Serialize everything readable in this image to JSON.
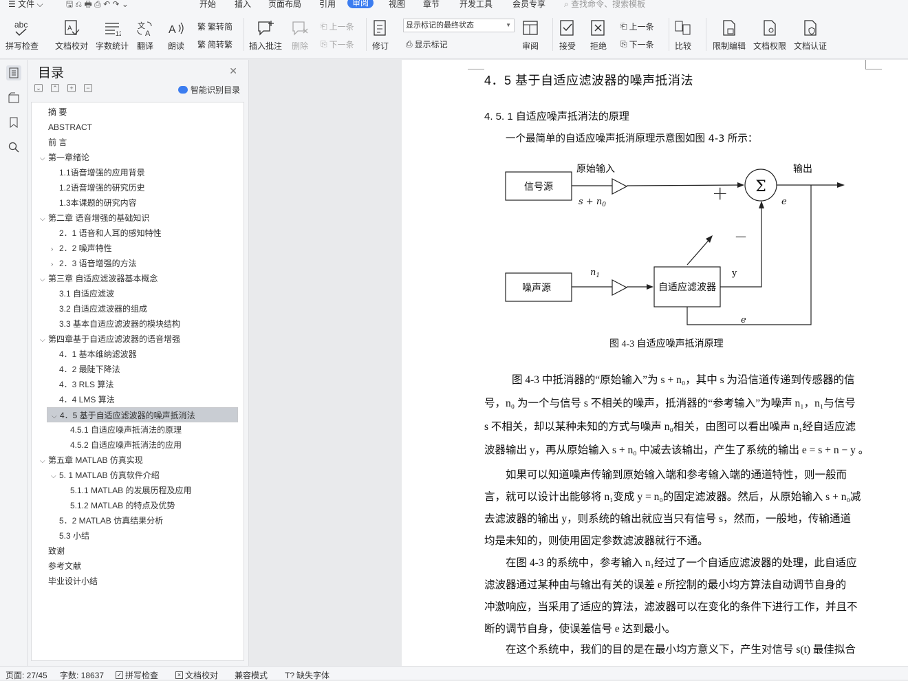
{
  "menubar": {
    "file": "文件",
    "tabs": [
      "开始",
      "插入",
      "页面布局",
      "引用",
      "审阅",
      "视图",
      "章节",
      "开发工具",
      "会员专享"
    ],
    "active_tab": "审阅",
    "search_placeholder": "查找命令、搜索模板"
  },
  "ribbon": {
    "spell_check": "拼写检查",
    "doc_proof": "文档校对",
    "word_count": "字数统计",
    "translate": "翻译",
    "read_aloud": "朗读",
    "trad_to_simp": "繁转简",
    "simp_to_trad": "简转繁",
    "insert_comment": "插入批注",
    "delete": "删除",
    "prev": "上一条",
    "next": "下一条",
    "revise": "修订",
    "markup_state": "显示标记的最终状态",
    "show_markup": "显示标记",
    "review": "审阅",
    "accept": "接受",
    "reject": "拒绝",
    "prev2": "上一条",
    "next2": "下一条",
    "compare": "比较",
    "restrict_edit": "限制编辑",
    "doc_permission": "文档权限",
    "doc_certify": "文档认证"
  },
  "toc": {
    "title": "目录",
    "smart_label": "智能识别目录",
    "items": [
      {
        "label": "摘  要",
        "level": 1,
        "caret": ""
      },
      {
        "label": "ABSTRACT",
        "level": 1,
        "caret": ""
      },
      {
        "label": "前  言",
        "level": 1,
        "caret": ""
      },
      {
        "label": "第一章绪论",
        "level": 1,
        "caret": "v"
      },
      {
        "label": "1.1语音增强的应用背景",
        "level": 2,
        "caret": ""
      },
      {
        "label": "1.2语音增强的研究历史",
        "level": 2,
        "caret": ""
      },
      {
        "label": "1.3本课题的研究内容",
        "level": 2,
        "caret": ""
      },
      {
        "label": "第二章  语音增强的基础知识",
        "level": 1,
        "caret": "v"
      },
      {
        "label": "2．1  语音和人耳的感知特性",
        "level": 2,
        "caret": ""
      },
      {
        "label": "2．2  噪声特性",
        "level": 2,
        "caret": ">"
      },
      {
        "label": "2．3    语音增强的方法",
        "level": 2,
        "caret": ">"
      },
      {
        "label": "第三章    自适应滤波器基本概念",
        "level": 1,
        "caret": "v"
      },
      {
        "label": "3.1 自适应滤波",
        "level": 2,
        "caret": ""
      },
      {
        "label": "3.2 自适应滤波器的组成",
        "level": 2,
        "caret": ""
      },
      {
        "label": "3.3 基本自适应滤波器的模块结构",
        "level": 2,
        "caret": ""
      },
      {
        "label": "第四章基于自适应滤波器的语音增强",
        "level": 1,
        "caret": "v"
      },
      {
        "label": "4．1      基本维纳滤波器",
        "level": 2,
        "caret": ""
      },
      {
        "label": "4．2 最陡下降法",
        "level": 2,
        "caret": ""
      },
      {
        "label": "4．3    RLS 算法",
        "level": 2,
        "caret": ""
      },
      {
        "label": "4．4    LMS 算法",
        "level": 2,
        "caret": ""
      },
      {
        "label": "4．5  基于自适应滤波器的噪声抵消法",
        "level": 2,
        "caret": "v",
        "selected": true
      },
      {
        "label": "4.5.1 自适应噪声抵消法的原理",
        "level": 3,
        "caret": ""
      },
      {
        "label": "4.5.2 自适应噪声抵消法的应用",
        "level": 3,
        "caret": ""
      },
      {
        "label": "第五章  MATLAB 仿真实现",
        "level": 1,
        "caret": "v"
      },
      {
        "label": "5. 1  MATLAB 仿真软件介绍",
        "level": 2,
        "caret": "v"
      },
      {
        "label": "5.1.1 MATLAB 的发展历程及应用",
        "level": 3,
        "caret": ""
      },
      {
        "label": "5.1.2    MATLAB 的特点及优势",
        "level": 3,
        "caret": ""
      },
      {
        "label": "5．2    MATLAB 仿真结果分析",
        "level": 2,
        "caret": ""
      },
      {
        "label": "5.3 小结",
        "level": 2,
        "caret": ""
      },
      {
        "label": "致谢",
        "level": 1,
        "caret": ""
      },
      {
        "label": "参考文献",
        "level": 1,
        "caret": ""
      },
      {
        "label": "毕业设计小结",
        "level": 1,
        "caret": ""
      }
    ]
  },
  "doc": {
    "heading": "4．5  基于自适应滤波器的噪声抵消法",
    "subheading": "4. 5. 1 自适应噪声抵消法的原理",
    "intro": "一个最简单的自适应噪声抵消原理示意图如图 4-3 所示：",
    "figure": {
      "signal_source": "信号源",
      "noise_source": "噪声源",
      "raw_input": "原始输入",
      "output": "输出",
      "adaptive_filter": "自适应滤波器",
      "s_n0": "s + n",
      "s_n0_sub": "0",
      "n1": "n",
      "n1_sub": "1",
      "sigma": "Σ",
      "e1": "e",
      "e2": "e",
      "y": "y",
      "plus": "+",
      "minus": "—"
    },
    "caption": "图 4-3      自适应噪声抵消原理",
    "lines": [
      "图 4-3 中抵消器的“原始输入”为 s + n₀，其中 s 为沿信道传递到传感器的信",
      "号，n₀ 为一个与信号 s 不相关的噪声，抵消器的“参考输入”为噪声 n₁，n₁与信号",
      "s 不相关，却以某种未知的方式与噪声 n₀相关，由图可以看出噪声 n₁经自适应滤",
      "波器输出 y，再从原始输入 s + n₀ 中减去该输出，产生了系统的输出 e = s + n − y 。",
      "如果可以知道噪声传输到原始输入端和参考输入端的通道特性，则一般而",
      "言，就可以设计出能够将 n₁变成 y = n₀的固定滤波器。然后，从原始输入 s + n₀减",
      "去滤波器的输出 y，则系统的输出就应当只有信号 s，然而，一般地，传输通道",
      "均是未知的，则使用固定参数滤波器就行不通。",
      "在图 4-3 的系统中，参考输入 n₁经过了一个自适应滤波器的处理，此自适应",
      "滤波器通过某种由与输出有关的误差 e 所控制的最小均方算法自动调节自身的",
      "冲激响应，当采用了适应的算法，滤波器可以在变化的条件下进行工作，并且不",
      "断的调节自身，使误差信号 e 达到最小。",
      "在这个系统中，我们的目的是在最小均方意义下，产生对信号 s(t) 最佳拟合"
    ]
  },
  "status": {
    "page": "页面: 27/45",
    "words": "字数: 18637",
    "spell": "拼写检查",
    "proof": "文档校对",
    "compat": "兼容模式",
    "missing_font": "缺失字体"
  }
}
